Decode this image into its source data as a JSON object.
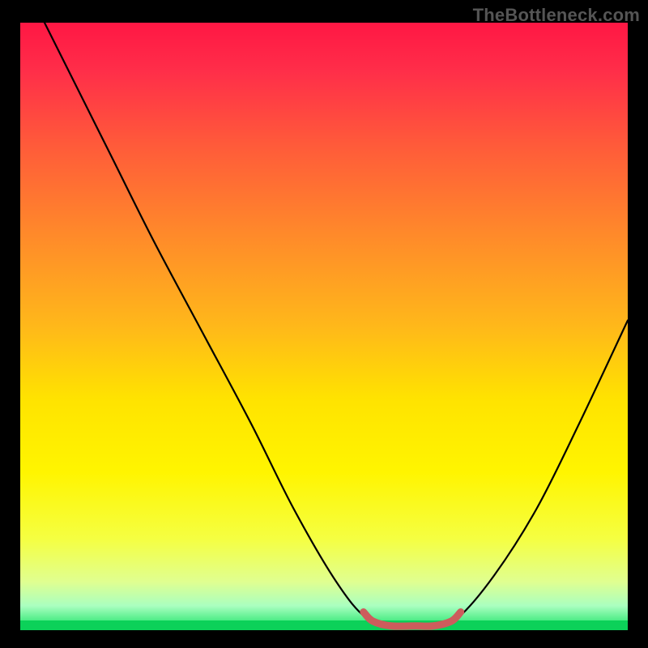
{
  "watermark": "TheBottleneck.com",
  "chart_data": {
    "type": "line",
    "title": "",
    "xlabel": "",
    "ylabel": "",
    "xlim": [
      0,
      100
    ],
    "ylim": [
      0,
      100
    ],
    "grid": false,
    "legend": false,
    "background_gradient": {
      "stops": [
        {
          "offset": 0.0,
          "color": "#ff1744"
        },
        {
          "offset": 0.08,
          "color": "#ff2e49"
        },
        {
          "offset": 0.2,
          "color": "#ff5a3a"
        },
        {
          "offset": 0.35,
          "color": "#ff8a2a"
        },
        {
          "offset": 0.5,
          "color": "#ffb81a"
        },
        {
          "offset": 0.62,
          "color": "#ffe300"
        },
        {
          "offset": 0.74,
          "color": "#fff500"
        },
        {
          "offset": 0.85,
          "color": "#f5ff42"
        },
        {
          "offset": 0.92,
          "color": "#e0ff90"
        },
        {
          "offset": 0.96,
          "color": "#aaffc0"
        },
        {
          "offset": 1.0,
          "color": "#10e060"
        }
      ]
    },
    "series": [
      {
        "name": "bottleneck-curve",
        "color": "#000000",
        "fill": false,
        "points": [
          {
            "x": 4,
            "y": 100
          },
          {
            "x": 8,
            "y": 92
          },
          {
            "x": 15,
            "y": 78
          },
          {
            "x": 22,
            "y": 64
          },
          {
            "x": 30,
            "y": 49
          },
          {
            "x": 38,
            "y": 34
          },
          {
            "x": 45,
            "y": 20
          },
          {
            "x": 52,
            "y": 8
          },
          {
            "x": 57,
            "y": 2
          },
          {
            "x": 62,
            "y": 0.5
          },
          {
            "x": 68,
            "y": 0.5
          },
          {
            "x": 72,
            "y": 2
          },
          {
            "x": 78,
            "y": 9
          },
          {
            "x": 85,
            "y": 20
          },
          {
            "x": 92,
            "y": 34
          },
          {
            "x": 100,
            "y": 51
          }
        ]
      },
      {
        "name": "optimal-region",
        "color": "#cd5c5c",
        "fill": false,
        "stroke_width": 9,
        "points": [
          {
            "x": 56.5,
            "y": 3.0
          },
          {
            "x": 58,
            "y": 1.5
          },
          {
            "x": 61,
            "y": 0.7
          },
          {
            "x": 65,
            "y": 0.7
          },
          {
            "x": 68,
            "y": 0.7
          },
          {
            "x": 71,
            "y": 1.5
          },
          {
            "x": 72.5,
            "y": 3.0
          }
        ]
      }
    ],
    "annotations": []
  }
}
